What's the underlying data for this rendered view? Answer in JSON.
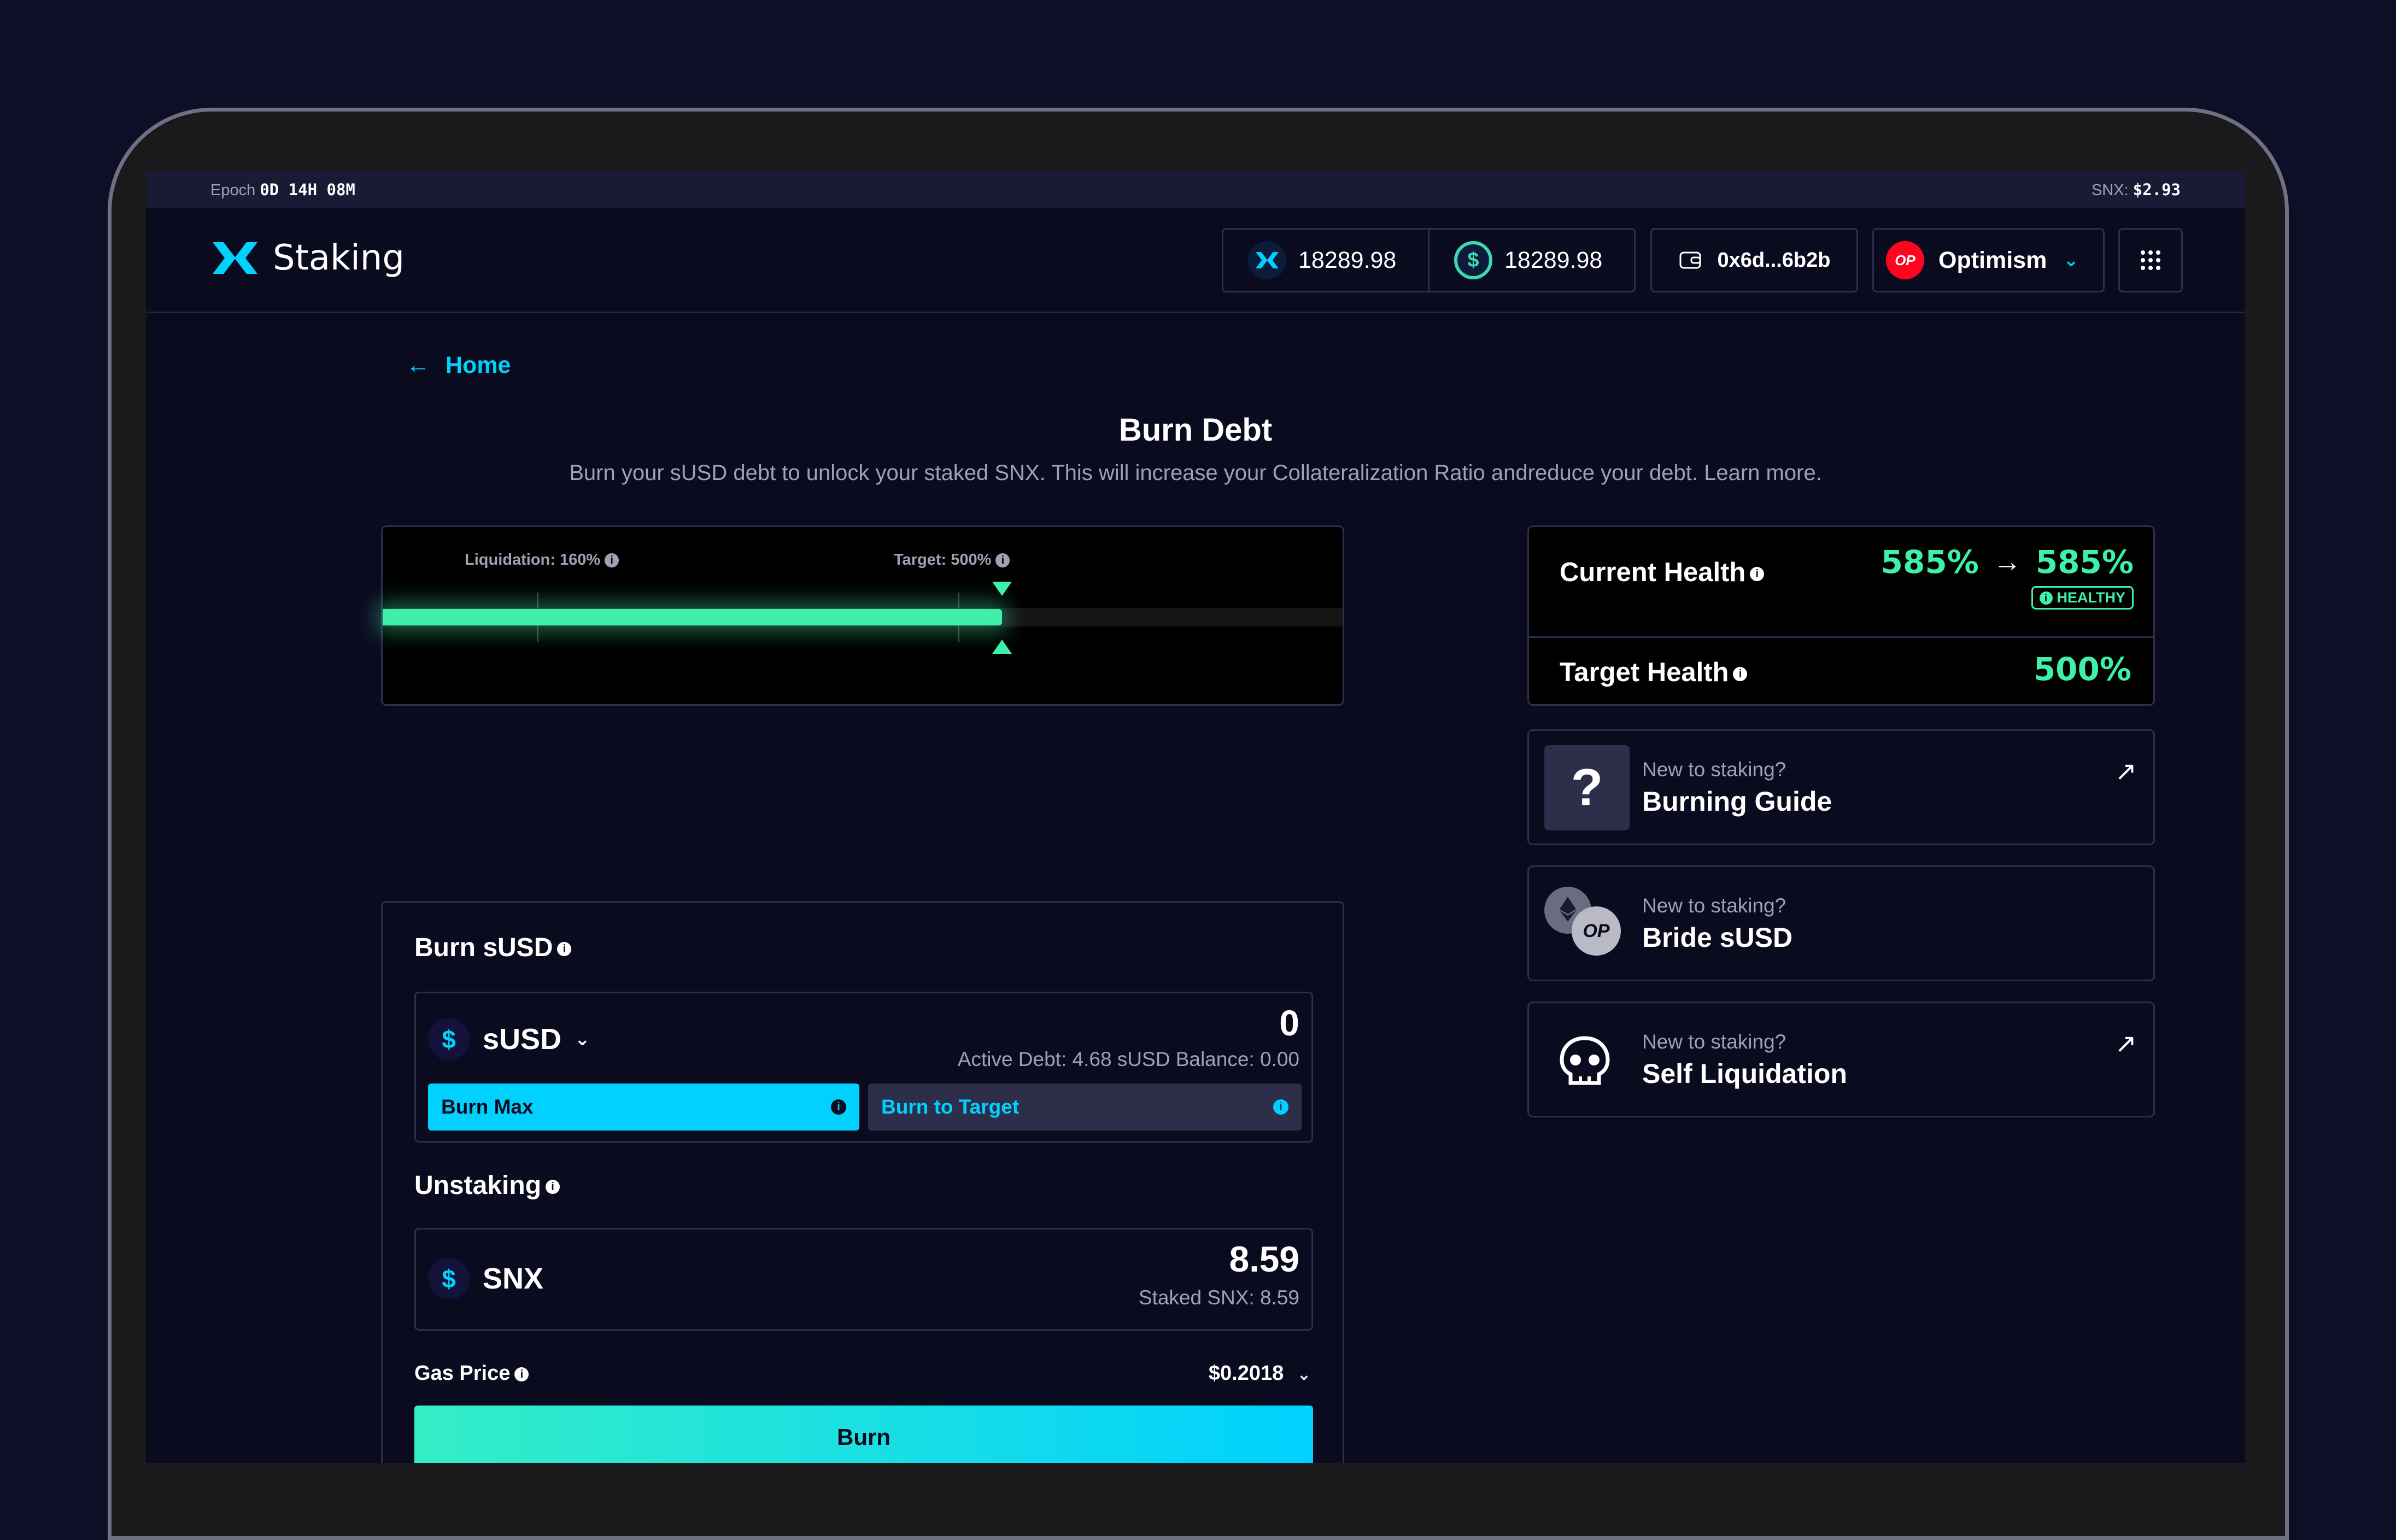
{
  "epoch": {
    "label": "Epoch",
    "value": "0D 14H 08M"
  },
  "snx_price": {
    "label": "SNX:",
    "value": "$2.93"
  },
  "app": {
    "name": "Staking"
  },
  "header": {
    "snx_balance": "18289.98",
    "susd_balance": "18289.98",
    "wallet_address": "0x6d...6b2b",
    "network": "Optimism",
    "network_badge": "OP"
  },
  "nav": {
    "back_label": "Home"
  },
  "page": {
    "title": "Burn Debt",
    "subtitle": "Burn your sUSD debt to unlock your staked SNX. This will increase your Collateralization Ratio andreduce your debt. Learn more."
  },
  "gauge": {
    "liquidation_label": "Liquidation: 160%",
    "target_label": "Target: 500%",
    "current_ratio": 5.85
  },
  "health": {
    "current_label": "Current Health",
    "current_from": "585%",
    "current_to": "585%",
    "status": "HEALTHY",
    "target_label": "Target Health",
    "target_value": "500%"
  },
  "burn": {
    "section_label": "Burn sUSD",
    "token": "sUSD",
    "amount": "0",
    "meta": "Active Debt: 4.68 sUSD Balance: 0.00",
    "burn_max_label": "Burn Max",
    "burn_target_label": "Burn to Target"
  },
  "unstake": {
    "section_label": "Unstaking",
    "token": "SNX",
    "amount": "8.59",
    "meta": "Staked SNX: 8.59"
  },
  "gas": {
    "label": "Gas Price",
    "value": "$0.2018"
  },
  "submit": {
    "label": "Burn"
  },
  "cards": [
    {
      "small": "New to staking?",
      "title": "Burning Guide"
    },
    {
      "small": "New to staking?",
      "title": "Bride sUSD"
    },
    {
      "small": "New to staking?",
      "title": "Self Liquidation"
    }
  ],
  "colors": {
    "accent_cyan": "#00d1ff",
    "accent_green": "#3ff0a8",
    "background": "#0b0b1f"
  }
}
